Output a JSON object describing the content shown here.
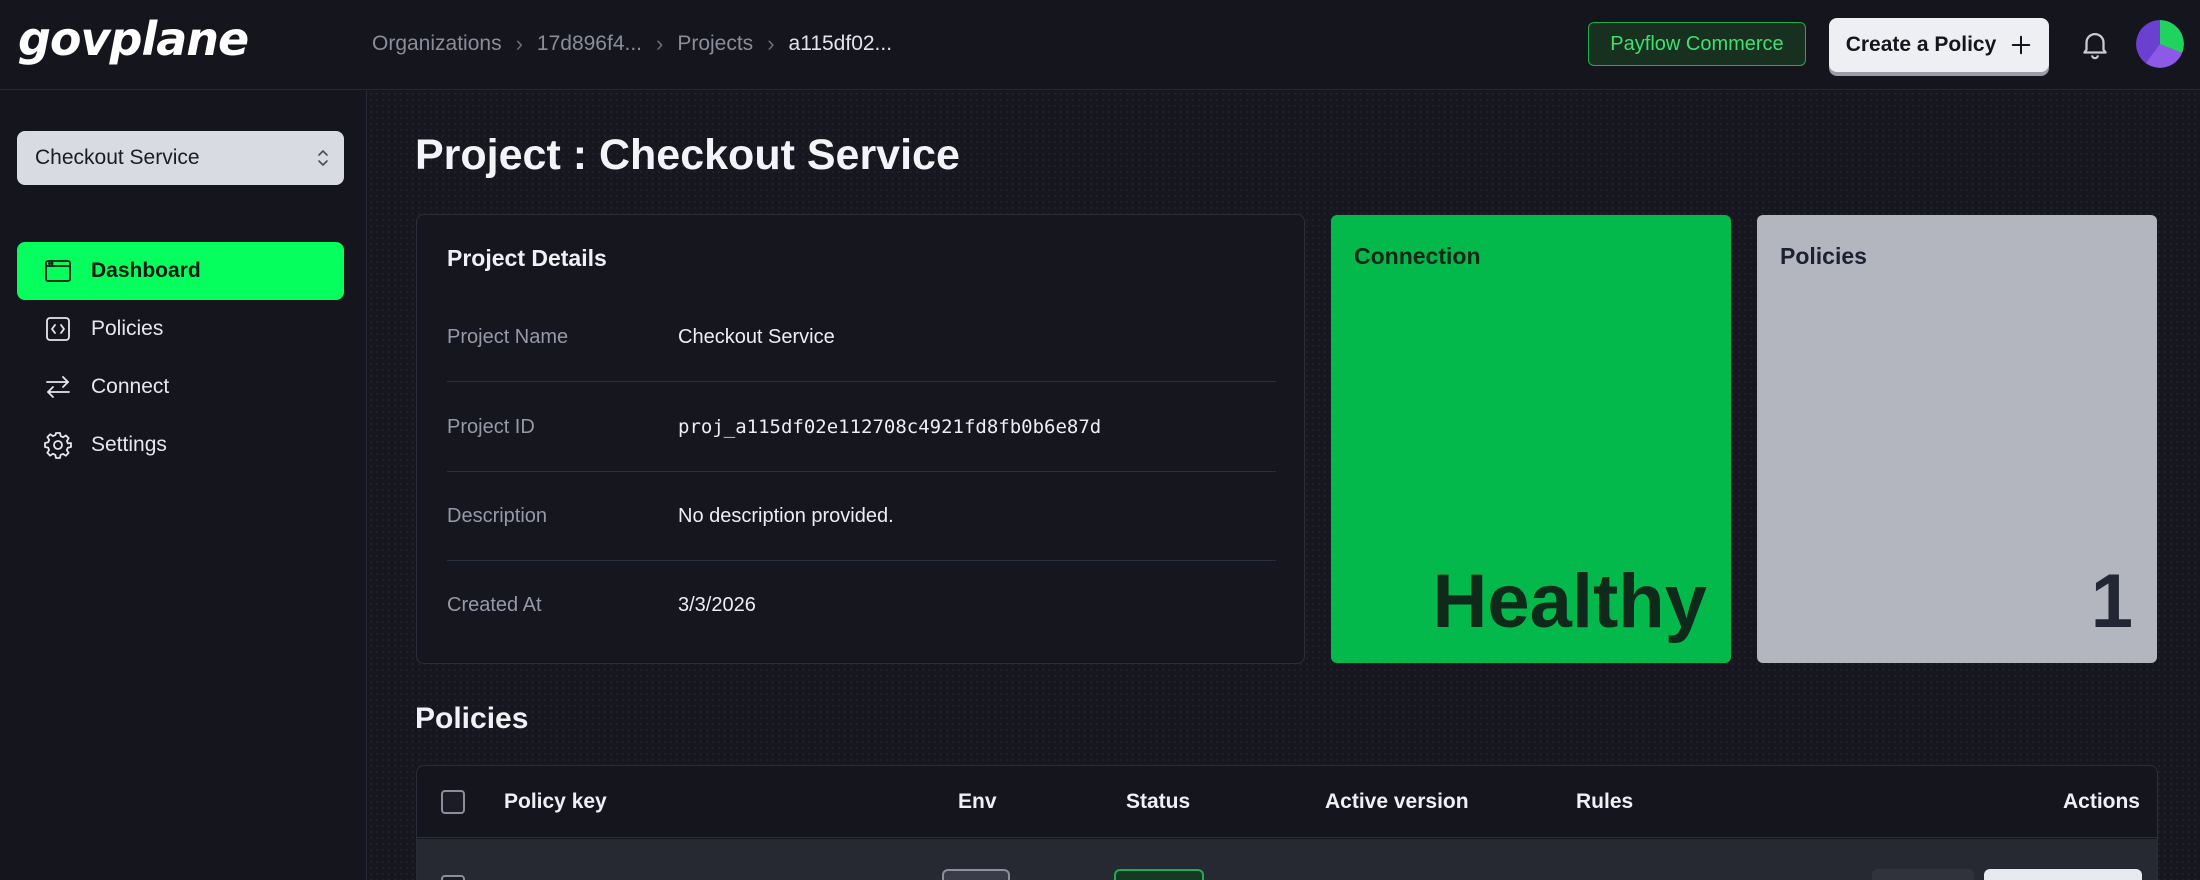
{
  "app": {
    "logo": "govplane"
  },
  "breadcrumb": [
    {
      "label": "Organizations"
    },
    {
      "label": "17d896f4..."
    },
    {
      "label": "Projects"
    },
    {
      "label": "a115df02..."
    }
  ],
  "header": {
    "org_badge": "Payflow Commerce",
    "create_button": "Create a Policy"
  },
  "sidebar": {
    "project_select": "Checkout Service",
    "items": [
      {
        "label": "Dashboard",
        "icon": "dashboard-icon",
        "active": true
      },
      {
        "label": "Policies",
        "icon": "code-icon",
        "active": false
      },
      {
        "label": "Connect",
        "icon": "arrows-swap-icon",
        "active": false
      },
      {
        "label": "Settings",
        "icon": "gear-icon",
        "active": false
      }
    ]
  },
  "main": {
    "title": "Project : Checkout Service",
    "details": {
      "heading": "Project Details",
      "rows": [
        {
          "key": "Project Name",
          "value": "Checkout Service"
        },
        {
          "key": "Project ID",
          "value": "proj_a115df02e112708c4921fd8fb0b6e87d"
        },
        {
          "key": "Description",
          "value": "No description provided."
        },
        {
          "key": "Created At",
          "value": "3/3/2026"
        }
      ]
    },
    "connection": {
      "label": "Connection",
      "value": "Healthy"
    },
    "policies_stat": {
      "label": "Policies",
      "value": "1"
    },
    "policies_section": {
      "title": "Policies",
      "columns": [
        "Policy key",
        "Env",
        "Status",
        "Active version",
        "Rules",
        "Actions"
      ]
    }
  },
  "colors": {
    "accent_green": "#05ff5c",
    "connection_card": "#03b94b",
    "policies_card": "#b3b5bf",
    "background": "#15151e"
  }
}
